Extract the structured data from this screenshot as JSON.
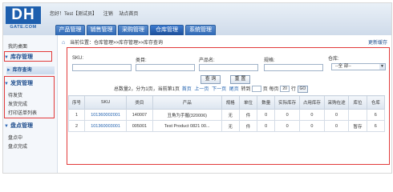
{
  "logo": {
    "main": "DH",
    "sub": "GATE.COM"
  },
  "topbar": {
    "greeting": "您好！Test【测试员】",
    "logout": "注销",
    "home": "站点首页"
  },
  "nav": {
    "tabs": [
      {
        "label": "产品管理"
      },
      {
        "label": "销售管理"
      },
      {
        "label": "采购管理"
      },
      {
        "label": "仓库管理"
      },
      {
        "label": "系统管理"
      }
    ]
  },
  "sidebar": {
    "my_desk": "我的桌面",
    "stock_mgmt": "库存管理",
    "stock_query": "库存查询",
    "shipping_mgmt": "发货管理",
    "shipping_items": [
      "待发货",
      "发货完成",
      "打印送单列表"
    ],
    "inventory": "盘点管理",
    "inventory_items": [
      "盘点中",
      "盘点完成"
    ]
  },
  "breadcrumb": {
    "text": "当前位置：仓库管理>>库存管理>>库存查询"
  },
  "more_link": "更新缓存",
  "filters": {
    "sku": "SKU:",
    "category": "类目:",
    "product_name": "产品名:",
    "spec": "规格:",
    "warehouse": "仓库:",
    "warehouse_value": "--全 部--"
  },
  "buttons": {
    "query": "查 询",
    "reset": "重 置"
  },
  "pager": {
    "summary": "总数量2，分为1页，当前第1页",
    "first": "首页",
    "prev": "上一页",
    "next": "下一页",
    "last": "尾页",
    "goto": "转到",
    "page_unit": "页 每页",
    "per_page": "20",
    "rows_unit": "行",
    "go": "GO"
  },
  "table": {
    "columns": [
      "序号",
      "SKU",
      "类目",
      "产品",
      "规格",
      "单位",
      "数量",
      "实际库存",
      "占用库存",
      "采购在途",
      "库位",
      "仓库"
    ],
    "rows": [
      [
        "1",
        "101360002001",
        "140007",
        "丑角为手握(320006)",
        "无",
        "件",
        "0",
        "0",
        "0",
        "0",
        "",
        "6"
      ],
      [
        "2",
        "101360003001",
        "005001",
        "Test Product 0821 00...",
        "无",
        "件",
        "0",
        "0",
        "0",
        "0",
        "暂存",
        "6"
      ]
    ]
  }
}
